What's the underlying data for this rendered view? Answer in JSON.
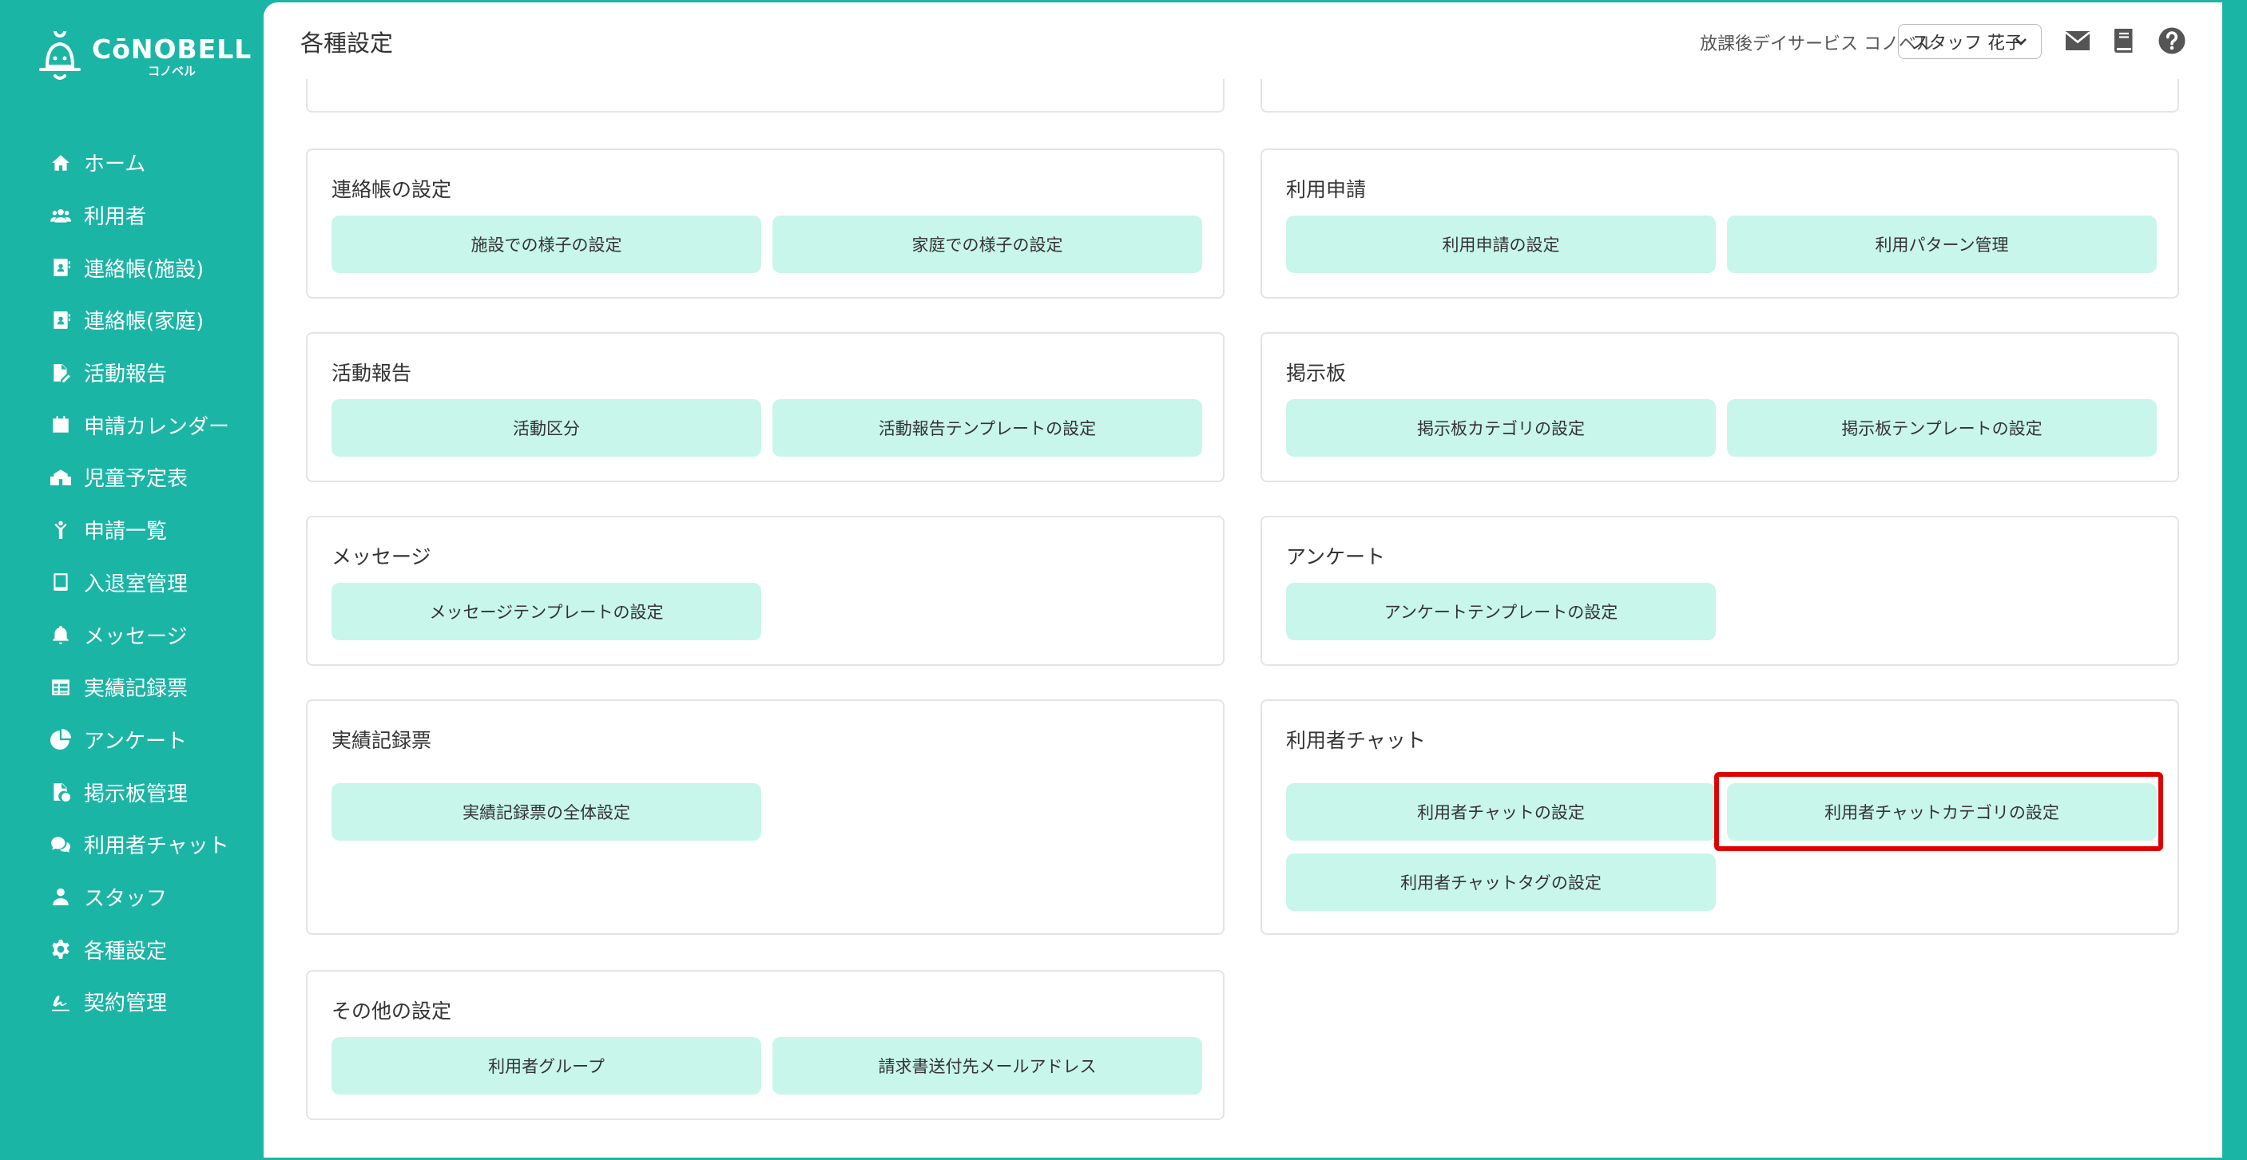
{
  "app": {
    "logo_main": "CōNOBELL",
    "logo_sub": "コノベル"
  },
  "sidebar": {
    "items": [
      {
        "label": "ホーム",
        "icon": "home-icon"
      },
      {
        "label": "利用者",
        "icon": "users-icon"
      },
      {
        "label": "連絡帳(施設)",
        "icon": "contact-book-icon"
      },
      {
        "label": "連絡帳(家庭)",
        "icon": "contact-book-icon"
      },
      {
        "label": "活動報告",
        "icon": "file-edit-icon"
      },
      {
        "label": "申請カレンダー",
        "icon": "calendar-icon"
      },
      {
        "label": "児童予定表",
        "icon": "school-icon"
      },
      {
        "label": "申請一覧",
        "icon": "child-icon"
      },
      {
        "label": "入退室管理",
        "icon": "tablet-icon"
      },
      {
        "label": "メッセージ",
        "icon": "bell-icon"
      },
      {
        "label": "実績記録票",
        "icon": "table-icon"
      },
      {
        "label": "アンケート",
        "icon": "pie-chart-icon"
      },
      {
        "label": "掲示板管理",
        "icon": "file-check-icon"
      },
      {
        "label": "利用者チャット",
        "icon": "chat-icon"
      },
      {
        "label": "スタッフ",
        "icon": "staff-icon"
      },
      {
        "label": "各種設定",
        "icon": "gear-icon"
      },
      {
        "label": "契約管理",
        "icon": "signature-icon"
      }
    ]
  },
  "header": {
    "title": "各種設定",
    "facility": "放課後デイサービス コノベル",
    "staff_select": "スタッフ 花子",
    "icons": [
      "mail-icon",
      "book-icon",
      "help-icon"
    ]
  },
  "sections": {
    "renrakucho": {
      "title": "連絡帳の設定",
      "buttons": [
        "施設での様子の設定",
        "家庭での様子の設定"
      ]
    },
    "riyo_shinsei": {
      "title": "利用申請",
      "buttons": [
        "利用申請の設定",
        "利用パターン管理"
      ]
    },
    "katsudo": {
      "title": "活動報告",
      "buttons": [
        "活動区分",
        "活動報告テンプレートの設定"
      ]
    },
    "keijiban": {
      "title": "掲示板",
      "buttons": [
        "掲示板カテゴリの設定",
        "掲示板テンプレートの設定"
      ]
    },
    "message": {
      "title": "メッセージ",
      "buttons": [
        "メッセージテンプレートの設定"
      ]
    },
    "enquete": {
      "title": "アンケート",
      "buttons": [
        "アンケートテンプレートの設定"
      ]
    },
    "jisseki": {
      "title": "実績記録票",
      "buttons": [
        "実績記録票の全体設定"
      ]
    },
    "chat": {
      "title": "利用者チャット",
      "buttons": [
        "利用者チャットの設定",
        "利用者チャットカテゴリの設定",
        "利用者チャットタグの設定"
      ]
    },
    "other": {
      "title": "その他の設定",
      "buttons": [
        "利用者グループ",
        "請求書送付先メールアドレス"
      ]
    }
  },
  "colors": {
    "brand": "#1bb5a6",
    "button_bg": "#c8f6ea",
    "highlight": "#e00000"
  }
}
